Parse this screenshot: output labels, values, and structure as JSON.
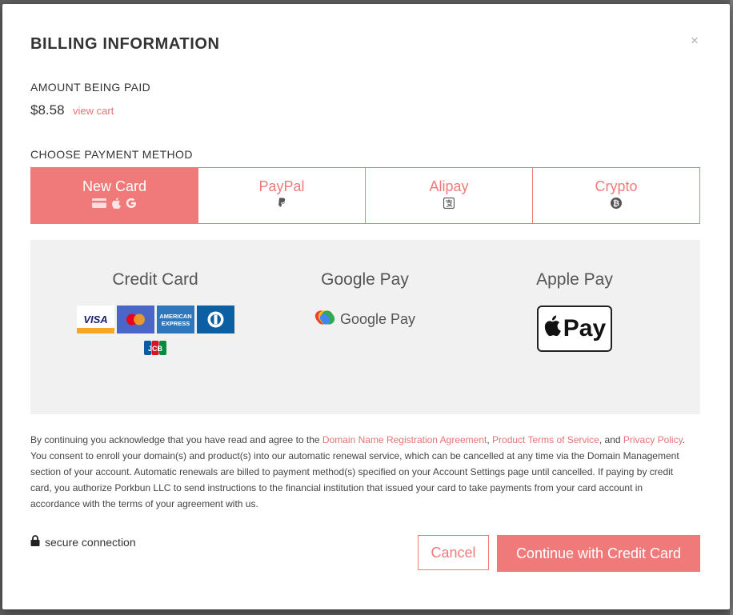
{
  "modal": {
    "title": "BILLING INFORMATION",
    "close_glyph": "×",
    "amount_label": "AMOUNT BEING PAID",
    "amount": "$8.58",
    "view_cart": "view cart",
    "method_label": "CHOOSE PAYMENT METHOD"
  },
  "tabs": [
    {
      "label": "New Card",
      "active": true,
      "icons": [
        "credit-card-icon",
        "apple-icon",
        "google-icon"
      ]
    },
    {
      "label": "PayPal",
      "active": false,
      "icons": [
        "paypal-icon"
      ]
    },
    {
      "label": "Alipay",
      "active": false,
      "icons": [
        "alipay-icon"
      ]
    },
    {
      "label": "Crypto",
      "active": false,
      "icons": [
        "bitcoin-icon"
      ]
    }
  ],
  "methods": {
    "credit_card": {
      "title": "Credit Card",
      "cards": [
        "VISA",
        "mastercard",
        "AMERICAN EXPRESS",
        "diners",
        "JCB"
      ]
    },
    "google_pay": {
      "title": "Google Pay",
      "badge_text": "Google Pay"
    },
    "apple_pay": {
      "title": "Apple Pay",
      "badge_text": "Pay"
    }
  },
  "legal": {
    "part1": "By continuing you acknowledge that you have read and agree to the ",
    "link1": "Domain Name Registration Agreement",
    "sep1": ", ",
    "link2": "Product Terms of Service",
    "sep2": ", and ",
    "link3": "Privacy Policy",
    "part2": ". You consent to enroll your domain(s) and product(s) into our automatic renewal service, which can be cancelled at any time via the Domain Management section of your account. Automatic renewals are billed to payment method(s) specified on your Account Settings page until cancelled. If paying by credit card, you authorize Porkbun LLC to send instructions to the financial institution that issued your card to take payments from your card account in accordance with the terms of your agreement with us."
  },
  "footer": {
    "secure_text": "secure connection",
    "cancel_label": "Cancel",
    "continue_label": "Continue with Credit Card"
  },
  "colors": {
    "accent": "#f07a7a",
    "link": "#e57373",
    "panel_bg": "#f1f1f1"
  }
}
